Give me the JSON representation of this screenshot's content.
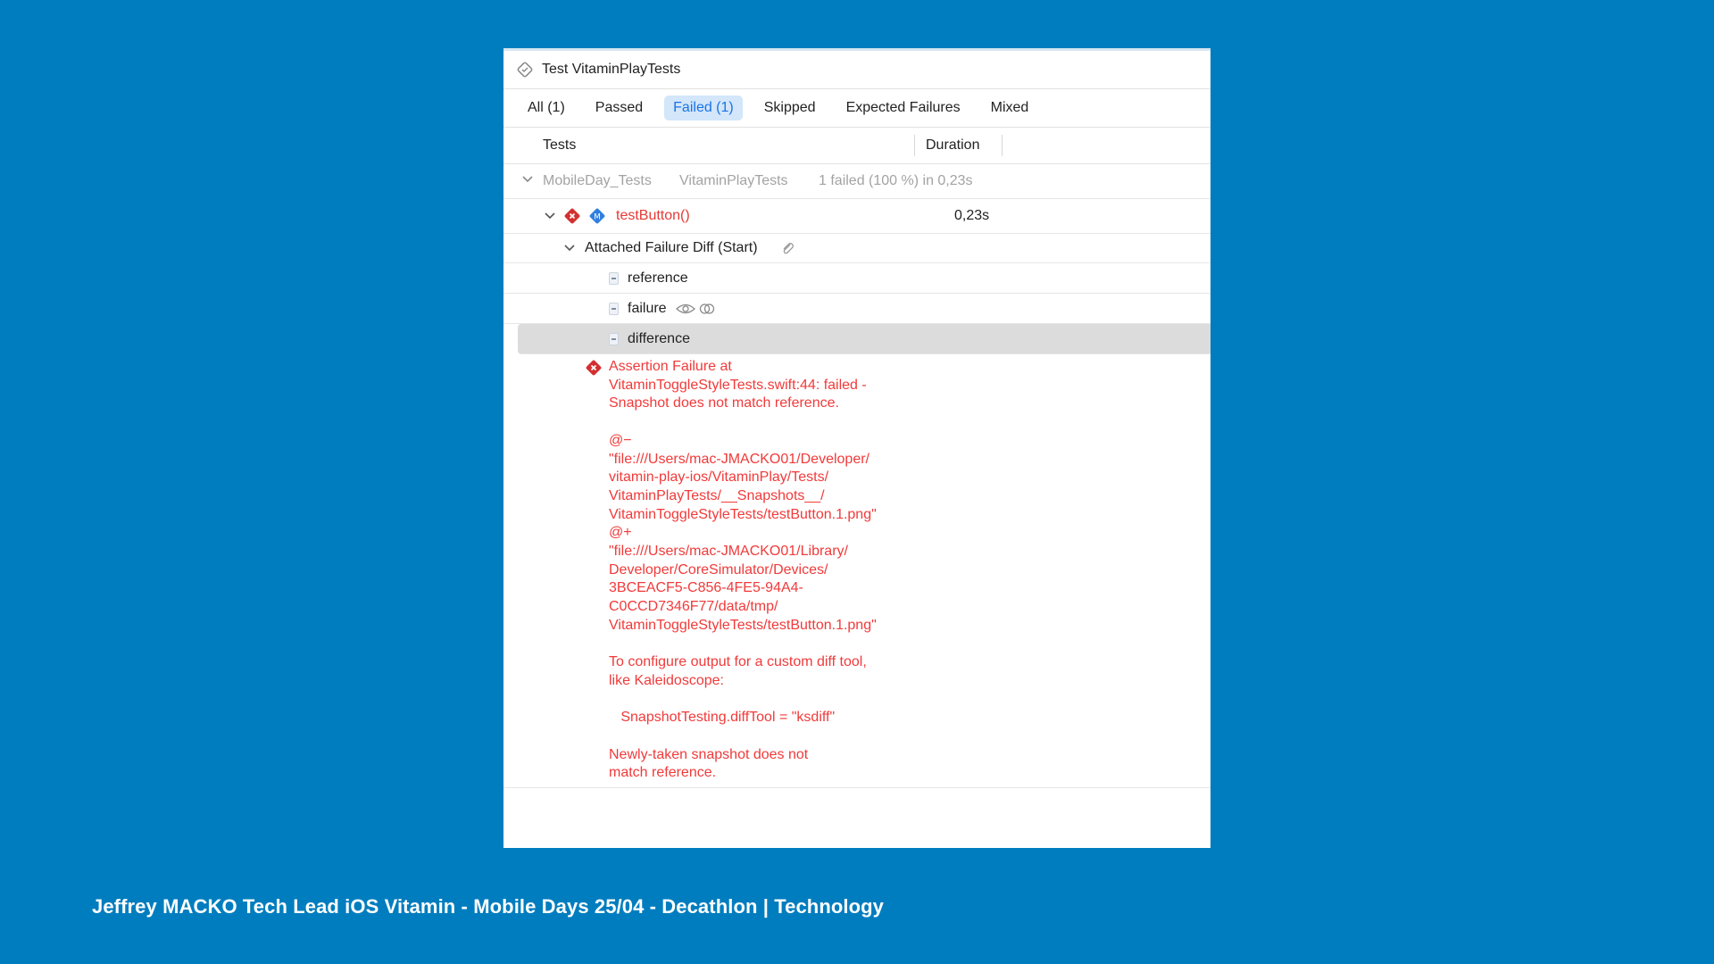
{
  "window": {
    "title": "Test VitaminPlayTests"
  },
  "tabs": [
    {
      "label": "All (1)",
      "active": false
    },
    {
      "label": "Passed",
      "active": false
    },
    {
      "label": "Failed (1)",
      "active": true
    },
    {
      "label": "Skipped",
      "active": false
    },
    {
      "label": "Expected Failures",
      "active": false
    },
    {
      "label": "Mixed",
      "active": false
    }
  ],
  "columns": {
    "tests": "Tests",
    "duration": "Duration"
  },
  "group": {
    "target": "MobileDay_Tests",
    "class": "VitaminPlayTests",
    "summary": "1 failed (100 %) in 0,23s"
  },
  "test": {
    "name": "testButton()",
    "duration": "0,23s"
  },
  "attachment": {
    "label": "Attached Failure Diff (Start)",
    "items": [
      {
        "label": "reference"
      },
      {
        "label": "failure"
      },
      {
        "label": "difference"
      }
    ]
  },
  "error": {
    "message": "Assertion Failure at\nVitaminToggleStyleTests.swift:44: failed -\nSnapshot does not match reference.\n\n@−\n\"file:///Users/mac-JMACKO01/Developer/\nvitamin-play-ios/VitaminPlay/Tests/\nVitaminPlayTests/__Snapshots__/\nVitaminToggleStyleTests/testButton.1.png\"\n@+\n\"file:///Users/mac-JMACKO01/Library/\nDeveloper/CoreSimulator/Devices/\n3BCEACF5-C856-4FE5-94A4-\nC0CCD7346F77/data/tmp/\nVitaminToggleStyleTests/testButton.1.png\"\n\nTo configure output for a custom diff tool,\nlike Kaleidoscope:\n\n   SnapshotTesting.diffTool = \"ksdiff\"\n\nNewly-taken snapshot does not\nmatch reference."
  },
  "footer": {
    "text": "Jeffrey MACKO Tech Lead iOS Vitamin - Mobile Days 25/04 - Decathlon | Technology"
  },
  "colors": {
    "background": "#007dbf",
    "failure": "#f13a3a",
    "accent": "#1a73e8"
  }
}
